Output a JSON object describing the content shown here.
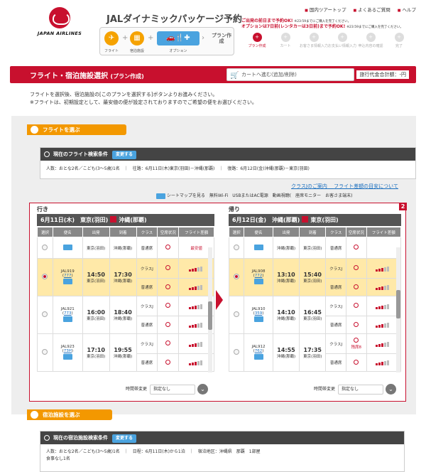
{
  "header": {
    "logo_text": "JAPAN AIRLINES",
    "top_links": [
      "国内ツアートップ",
      "よくあるご質問",
      "ヘルプ"
    ],
    "brand": "JALダイナミックパッケージ予約",
    "steps": [
      {
        "label": "フライト",
        "icon": "plane-icon"
      },
      {
        "label": "宿泊施設",
        "icon": "hotel-icon"
      },
      {
        "label": "オプション",
        "icon": "options-icon"
      }
    ],
    "plan_label": "プラン作成",
    "notice_line1": "ご出発の前日まで予約OK!",
    "notice_line1_small": "※23:59までにご購入を完了ください。",
    "notice_line2": "オプションは7日前(レンタカーは3日前)まで予約OK!",
    "notice_line2_small": "※23:59までにご購入を完了ください。",
    "progress": [
      "プラン作成",
      "カート",
      "お客さま情報入力",
      "お支払い情報入力",
      "申込内容の確認",
      "完了"
    ]
  },
  "banner": {
    "title": "フライト・宿泊施設選択",
    "subtitle": "(プラン作成)",
    "cart_label": "カートへ進む(追加/削除)",
    "total_label": "旅行代金合計額：",
    "total_value": "-円"
  },
  "intro": {
    "line1": "フライトを選択後、宿泊施設の[このプランを選択する]ボタンよりお進みください。",
    "line2": "※フライトは、初期設定として、最安値の便が設定されておりますのでご希望の便をお選びください。"
  },
  "flight_section": {
    "title": "フライトを選ぶ",
    "cond_title": "現在のフライト検索条件",
    "change_label": "変更する",
    "cond_people": "人数：おとな2名／こども(3〜5歳)1名",
    "cond_out": "往路：6月11日(木)東京(羽田)－沖縄(那覇)",
    "cond_ret": "復路：6月12日(金)沖縄(那覇)－東京(羽田)",
    "link1": "クラスJのご案内",
    "link2": "フライト差額の目安について",
    "legend": "シートマップを見る　無料Wi-Fi　USBまたはAC電源　動画視聴(　座席モニター　お客さま端末)"
  },
  "table_headers": [
    "選択",
    "便名",
    "出発",
    "到着",
    "クラス",
    "空席状況",
    "フライト差額"
  ],
  "outbound": {
    "dir": "行き",
    "date": "6月11日(木)",
    "from": "東京(羽田)",
    "to": "沖縄(那覇)",
    "rows": [
      {
        "flight": "",
        "dep": "",
        "arr": "",
        "dep_ap": "東京(羽田)",
        "arr_ap": "沖縄(那覇)",
        "class": "普通席",
        "note": "最安値",
        "sel": false,
        "partial": true
      },
      {
        "flight": "JAL919",
        "code": "777",
        "dep": "14:50",
        "arr": "17:30",
        "dep_ap": "東京(羽田)",
        "arr_ap": "沖縄(那覇)",
        "class1": "クラスJ",
        "class2": "普通席",
        "sel": true
      },
      {
        "flight": "JAL921",
        "code": "773",
        "dep": "16:00",
        "arr": "18:40",
        "dep_ap": "東京(羽田)",
        "arr_ap": "沖縄(那覇)",
        "class1": "クラスJ",
        "class2": "普通席",
        "sel": false
      },
      {
        "flight": "JAL923",
        "code": "73H",
        "dep": "17:10",
        "arr": "19:55",
        "dep_ap": "東京(羽田)",
        "arr_ap": "沖縄(那覇)",
        "class1": "クラスJ",
        "class2": "普通席",
        "sel": false
      }
    ]
  },
  "return": {
    "dir": "帰り",
    "date": "6月12日(金)",
    "from": "沖縄(那覇)",
    "to": "東京(羽田)",
    "rows": [
      {
        "flight": "",
        "dep": "",
        "arr": "",
        "dep_ap": "沖縄(那覇)",
        "arr_ap": "東京(羽田)",
        "class": "普通席",
        "sel": false,
        "partial": true
      },
      {
        "flight": "JAL908",
        "code": "772",
        "dep": "13:10",
        "arr": "15:40",
        "dep_ap": "沖縄(那覇)",
        "arr_ap": "東京(羽田)",
        "class1": "クラスJ",
        "class2": "普通席",
        "sel": true
      },
      {
        "flight": "JAL910",
        "code": "359",
        "dep": "14:10",
        "arr": "16:45",
        "dep_ap": "沖縄(那覇)",
        "arr_ap": "東京(羽田)",
        "class1": "クラスJ",
        "class2": "普通席",
        "sel": false
      },
      {
        "flight": "JAL912",
        "code": "762",
        "dep": "14:55",
        "arr": "17:35",
        "dep_ap": "沖縄(那覇)",
        "arr_ap": "東京(羽田)",
        "class1": "クラスJ",
        "class2": "普通席",
        "note": "残席8",
        "sel": false
      }
    ]
  },
  "time_change": {
    "label": "時間帯変更",
    "value": "指定なし"
  },
  "hotel_section": {
    "title": "宿泊施設を選ぶ",
    "cond_title": "現在の宿泊施設検索条件",
    "change_label": "変更する",
    "cond_people": "人数：おとな2名／こども(3〜5歳)1名",
    "cond_date": "日程：6月11日(木)から1泊",
    "cond_area": "宿泊地区：沖縄県　那覇　1部屋",
    "cond_meal": "食事なし1名"
  },
  "red_badge": "2",
  "colors": {
    "jal_red": "#c8102e",
    "orange": "#f39800",
    "highlight": "#ffe9a8"
  }
}
